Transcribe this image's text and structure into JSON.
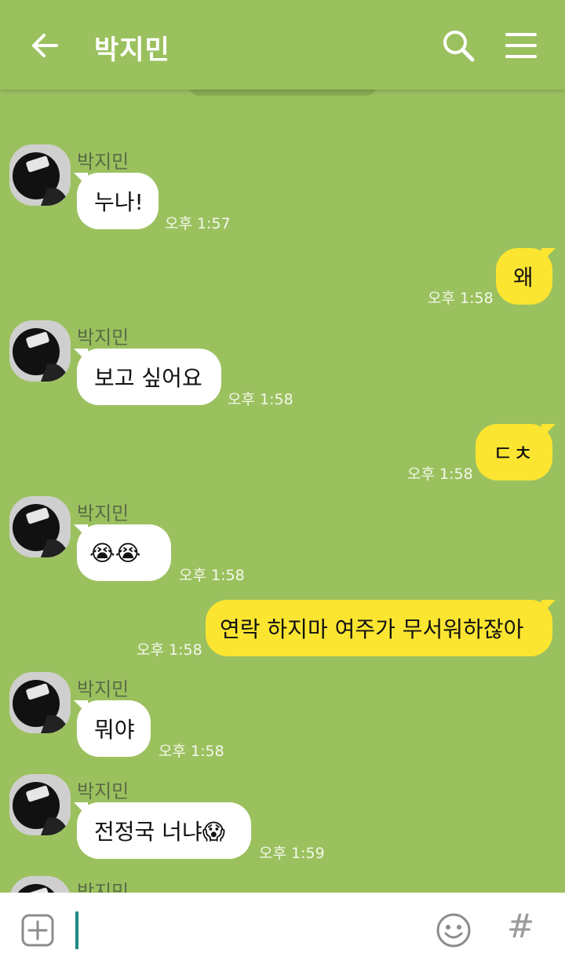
{
  "header": {
    "title": "박지민",
    "back_icon": "arrow-left-icon",
    "search_icon": "search-icon",
    "menu_icon": "hamburger-menu-icon"
  },
  "colors": {
    "background": "#9bc15f",
    "incoming_bubble": "#ffffff",
    "outgoing_bubble": "#fbe531",
    "input_bar": "#ffffff",
    "cursor": "#1f8b84"
  },
  "messages": [
    {
      "direction": "in",
      "sender": "박지민",
      "text": "누나!",
      "time": "오후 1:57"
    },
    {
      "direction": "out",
      "text": "왜",
      "time": "오후 1:58"
    },
    {
      "direction": "in",
      "sender": "박지민",
      "text": "보고 싶어요",
      "time": "오후 1:58"
    },
    {
      "direction": "out",
      "text": "ㄷㅊ",
      "time": "오후 1:58"
    },
    {
      "direction": "in",
      "sender": "박지민",
      "text": "😭😭",
      "time": "오후 1:58"
    },
    {
      "direction": "out",
      "text": "연락 하지마 여주가 무서워하잖아",
      "time": "오후 1:58"
    },
    {
      "direction": "in",
      "sender": "박지민",
      "text": "뭐야",
      "time": "오후 1:58"
    },
    {
      "direction": "in",
      "sender": "박지민",
      "text": "전정국 너냐😱",
      "time": "오후 1:59"
    },
    {
      "direction": "in",
      "sender": "박지민",
      "text": "",
      "time": ""
    }
  ],
  "input": {
    "plus_icon": "plus-square-icon",
    "emoji_icon": "smiley-icon",
    "hash_label": "#"
  }
}
